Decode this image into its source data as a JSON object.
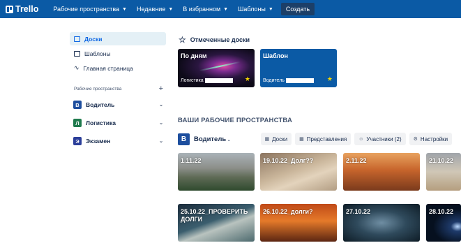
{
  "topbar": {
    "logo": "Trello",
    "nav": [
      "Рабочие пространства",
      "Недавние",
      "В избранном",
      "Шаблоны"
    ],
    "create": "Создать"
  },
  "sidebar": {
    "items": [
      {
        "label": "Доски",
        "icon": "board-icon"
      },
      {
        "label": "Шаблоны",
        "icon": "template-icon"
      },
      {
        "label": "Главная страница",
        "icon": "activity-icon"
      }
    ],
    "section_title": "Рабочие пространства",
    "workspaces": [
      {
        "letter": "В",
        "name": "Водитель",
        "color": "#1d4e9e"
      },
      {
        "letter": "Л",
        "name": "Логистика",
        "color": "#1f7a4d"
      },
      {
        "letter": "Э",
        "name": "Экзамен",
        "color": "#2b3e99"
      }
    ]
  },
  "starred": {
    "title": "Отмеченные доски",
    "boards": [
      {
        "title": "По дням",
        "workspace": "Логистика"
      },
      {
        "title": "Шаблон",
        "workspace": "Водитель"
      }
    ]
  },
  "workspaces_section": {
    "title": "ВАШИ РАБОЧИЕ ПРОСТРАНСТВА",
    "workspace": {
      "letter": "В",
      "name": "Водитель ."
    },
    "chips": [
      "Доски",
      "Представления",
      "Участники (2)",
      "Настройки"
    ],
    "cards": [
      "1.11.22",
      "19.10.22_Долг??",
      "2.11.22",
      "21.10.22",
      "25.10.22_ПРОВЕРИТЬ ДОЛГИ",
      "26.10.22_долги?",
      "27.10.22",
      "28.10.22"
    ]
  }
}
